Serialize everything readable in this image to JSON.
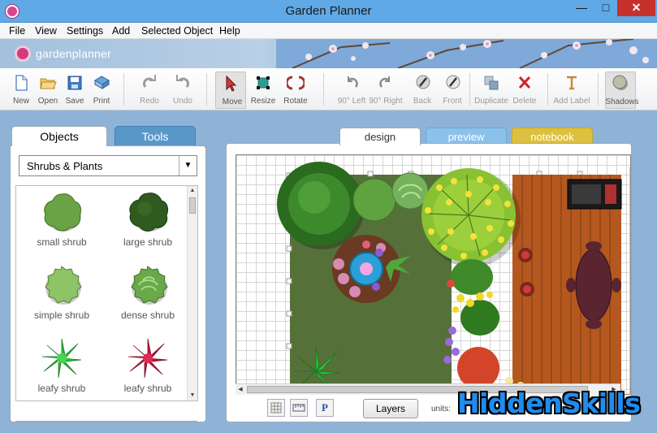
{
  "window": {
    "title": "Garden Planner",
    "minimize": "—",
    "maximize": "□",
    "close": "✕"
  },
  "menu": [
    "File",
    "View",
    "Settings",
    "Add",
    "Selected Object",
    "Help"
  ],
  "banner": {
    "logo_text": "gardenplanner"
  },
  "toolbar": [
    {
      "label": "New",
      "icon": "new-file-icon",
      "disabled": false
    },
    {
      "label": "Open",
      "icon": "folder-open-icon",
      "disabled": false
    },
    {
      "label": "Save",
      "icon": "save-icon",
      "disabled": false
    },
    {
      "label": "Print",
      "icon": "print-icon",
      "disabled": false
    },
    {
      "label": "Redo",
      "icon": "redo-icon",
      "disabled": true
    },
    {
      "label": "Undo",
      "icon": "undo-icon",
      "disabled": true
    },
    {
      "label": "Move",
      "icon": "pointer-arrow-icon",
      "disabled": false,
      "active": true
    },
    {
      "label": "Resize",
      "icon": "resize-icon",
      "disabled": false
    },
    {
      "label": "Rotate",
      "icon": "rotate-icon",
      "disabled": false
    },
    {
      "label": "90° Left",
      "icon": "rotate-left-icon",
      "disabled": true
    },
    {
      "label": "90° Right",
      "icon": "rotate-right-icon",
      "disabled": true
    },
    {
      "label": "Back",
      "icon": "send-back-icon",
      "disabled": true
    },
    {
      "label": "Front",
      "icon": "bring-front-icon",
      "disabled": true
    },
    {
      "label": "Duplicate",
      "icon": "duplicate-icon",
      "disabled": true
    },
    {
      "label": "Delete",
      "icon": "delete-x-icon",
      "disabled": true
    },
    {
      "label": "Add Label",
      "icon": "text-label-icon",
      "disabled": true
    },
    {
      "label": "Shadows",
      "icon": "shadow-icon",
      "disabled": false,
      "active": true
    }
  ],
  "left_panel": {
    "tabs": [
      "Objects",
      "Tools"
    ],
    "category": "Shrubs & Plants",
    "objects": [
      {
        "label": "small shrub",
        "icon": "small-shrub-icon"
      },
      {
        "label": "large shrub",
        "icon": "large-shrub-icon"
      },
      {
        "label": "simple shrub",
        "icon": "simple-shrub-icon"
      },
      {
        "label": "dense shrub",
        "icon": "dense-shrub-icon"
      },
      {
        "label": "leafy shrub",
        "icon": "leafy-shrub-green-icon"
      },
      {
        "label": "leafy shrub",
        "icon": "leafy-shrub-red-icon"
      }
    ]
  },
  "right_panel": {
    "tabs": [
      "design",
      "preview",
      "notebook"
    ],
    "layers_label": "Layers",
    "units_label": "units:",
    "view_buttons": [
      "grid-icon",
      "ruler-icon",
      "P"
    ]
  },
  "colors": {
    "titlebar": "#5fa9e6",
    "close_button": "#c7312b",
    "tab_preview": "#8cc1ea",
    "tab_notebook": "#dcc140",
    "lawn": "#56703a",
    "deck": "#b5581f"
  },
  "watermark": "HiddenSkills"
}
